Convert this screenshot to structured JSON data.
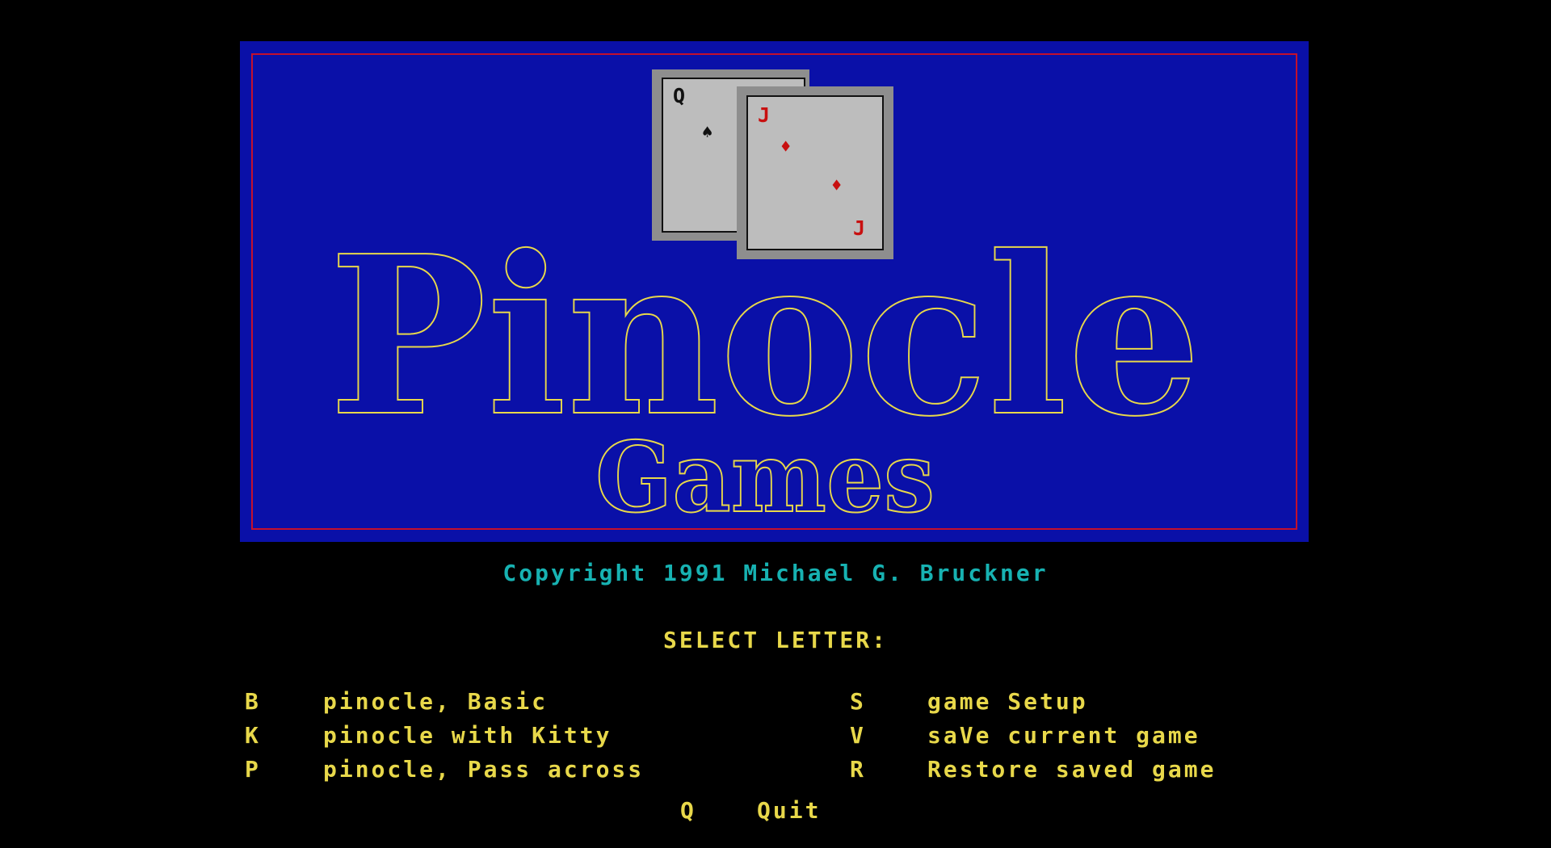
{
  "colors": {
    "background": "#000000",
    "banner": "#0a10a8",
    "banner_border": "#c4102c",
    "text_yellow": "#e8d84a",
    "text_cyan": "#17b2b2",
    "card_face": "#bdbdbd",
    "card_red": "#c81010"
  },
  "banner": {
    "title": "Pinocle",
    "subtitle": "Games",
    "cards": [
      {
        "rank": "Q",
        "suit": "spades",
        "suit_symbol": "♠"
      },
      {
        "rank": "J",
        "suit": "diamonds",
        "suit_symbol": "♦"
      }
    ]
  },
  "copyright": "Copyright 1991 Michael G. Bruckner",
  "prompt": "SELECT LETTER:",
  "menu": {
    "left": [
      {
        "key": "B",
        "label": "pinocle, Basic"
      },
      {
        "key": "K",
        "label": "pinocle with Kitty"
      },
      {
        "key": "P",
        "label": "pinocle, Pass across"
      }
    ],
    "right": [
      {
        "key": "S",
        "label": "game Setup"
      },
      {
        "key": "V",
        "label": "saVe current game"
      },
      {
        "key": "R",
        "label": "Restore saved game"
      }
    ],
    "quit": {
      "key": "Q",
      "label": "Quit"
    }
  }
}
